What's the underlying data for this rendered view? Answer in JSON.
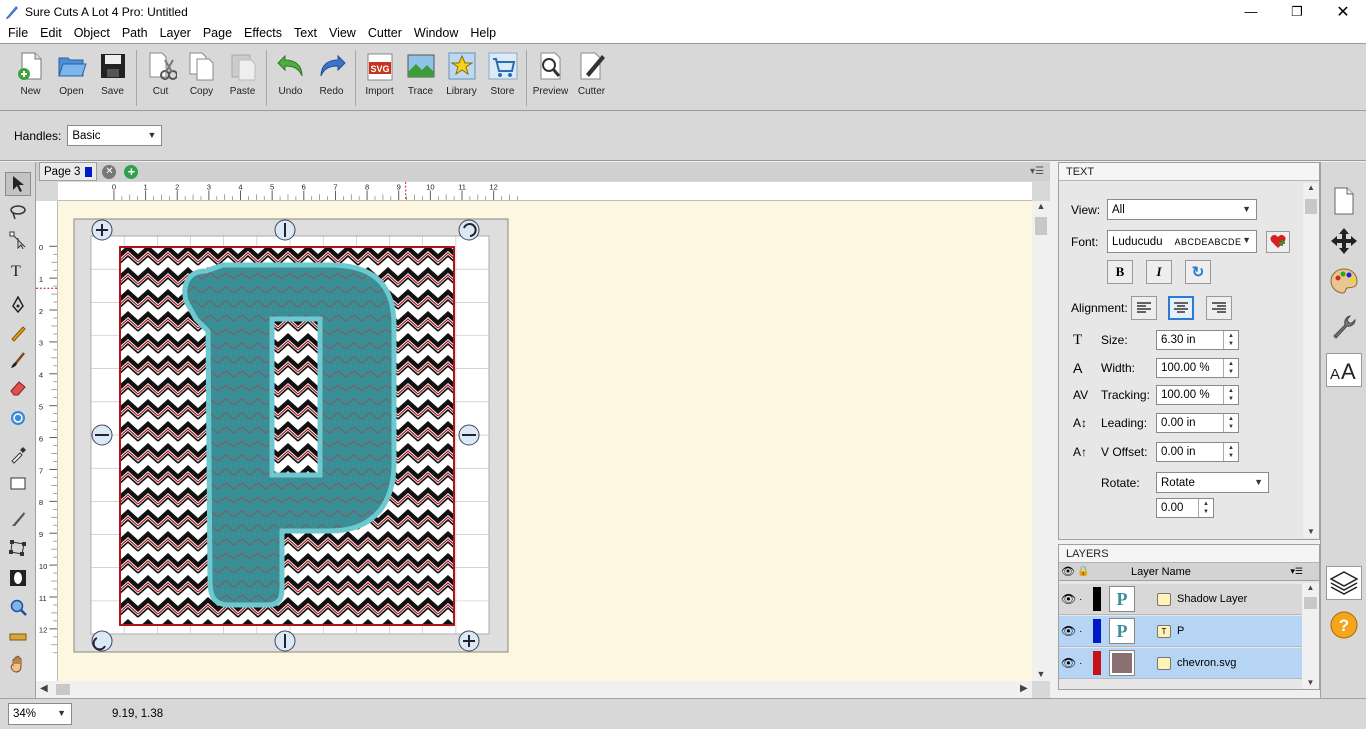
{
  "app": {
    "title": "Sure Cuts A Lot 4 Pro: Untitled",
    "window_controls": [
      "—",
      "❐",
      "✕"
    ]
  },
  "menu": [
    "File",
    "Edit",
    "Object",
    "Path",
    "Layer",
    "Page",
    "Effects",
    "Text",
    "View",
    "Cutter",
    "Window",
    "Help"
  ],
  "toolbar": {
    "new": "New",
    "open": "Open",
    "save": "Save",
    "cut": "Cut",
    "copy": "Copy",
    "paste": "Paste",
    "undo": "Undo",
    "redo": "Redo",
    "import": "Import",
    "trace": "Trace",
    "library": "Library",
    "store": "Store",
    "preview": "Preview",
    "cutter": "Cutter"
  },
  "handles": {
    "label": "Handles:",
    "value": "Basic"
  },
  "page_tab": {
    "label": "Page 3"
  },
  "ruler": {
    "h_labels": [
      "0",
      "1",
      "2",
      "3",
      "4",
      "5",
      "6",
      "7",
      "8",
      "9",
      "10",
      "11",
      "12"
    ],
    "v_labels": [
      "0",
      "1",
      "2",
      "3",
      "4",
      "5",
      "6",
      "7",
      "8",
      "9",
      "10",
      "11",
      "12"
    ]
  },
  "design": {
    "letter": "P"
  },
  "text_panel": {
    "header": "TEXT",
    "view_label": "View:",
    "view_value": "All",
    "font_label": "Font:",
    "font_value": "Luducudu",
    "font_preview": "ABCDEABCDE",
    "alignment_label": "Alignment:",
    "size_label": "Size:",
    "size_value": "6.30 in",
    "width_label": "Width:",
    "width_value": "100.00 %",
    "tracking_label": "Tracking:",
    "tracking_value": "100.00 %",
    "leading_label": "Leading:",
    "leading_value": "0.00 in",
    "voffset_label": "V Offset:",
    "voffset_value": "0.00 in",
    "rotate_label": "Rotate:",
    "rotate_value": "Rotate",
    "rotate_angle": "0.00"
  },
  "layers_panel": {
    "header": "LAYERS",
    "column": "Layer Name",
    "rows": [
      {
        "name": "Shadow Layer",
        "color": "#000000"
      },
      {
        "name": "P",
        "color": "#0018c8"
      },
      {
        "name": "chevron.svg",
        "color": "#c81018"
      }
    ]
  },
  "status": {
    "zoom": "34%",
    "coords": "9.19, 1.38"
  },
  "colors": {
    "page_bg": "#fdf7e0",
    "teal": "#3a8e95",
    "selected_row": "#b6d4f4",
    "accent_blue": "#2a7ad6"
  }
}
